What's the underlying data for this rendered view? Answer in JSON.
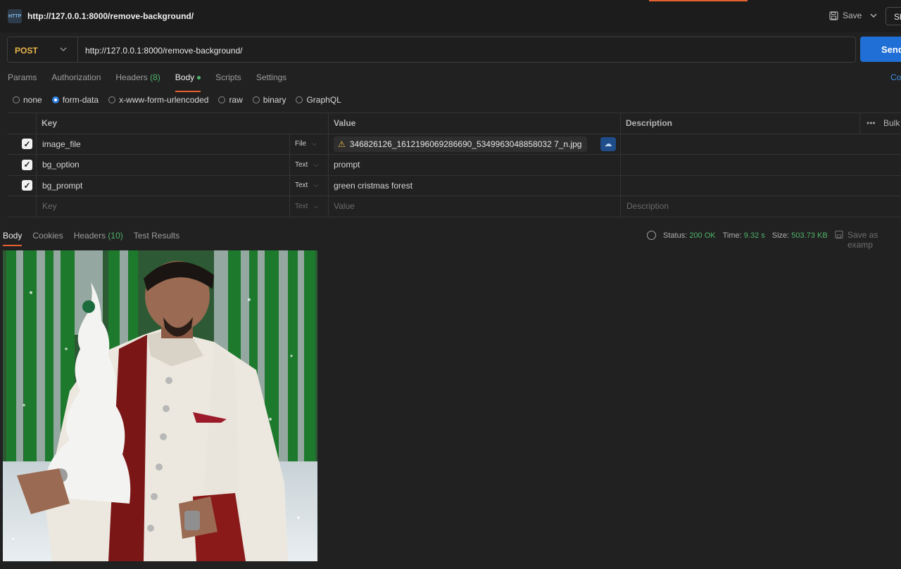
{
  "titlebar": {
    "request_title": "http://127.0.0.1:8000/remove-background/",
    "save_label": "Save",
    "share_label": "Sh",
    "req_icon_text": "HTTP"
  },
  "request": {
    "method": "POST",
    "url": "http://127.0.0.1:8000/remove-background/",
    "send_label": "Send"
  },
  "request_tabs": [
    {
      "label": "Params",
      "count": ""
    },
    {
      "label": "Authorization",
      "count": ""
    },
    {
      "label": "Headers",
      "count": "(8)"
    },
    {
      "label": "Body",
      "count": ""
    },
    {
      "label": "Scripts",
      "count": ""
    },
    {
      "label": "Settings",
      "count": ""
    }
  ],
  "code_link": "Co",
  "body_types": [
    "none",
    "form-data",
    "x-www-form-urlencoded",
    "raw",
    "binary",
    "GraphQL"
  ],
  "selected_body_type": "form-data",
  "table": {
    "headers": {
      "key": "Key",
      "value": "Value",
      "description": "Description",
      "bulk": "Bulk"
    },
    "rows": [
      {
        "key": "image_file",
        "type": "File",
        "value": "346826126_1612196069286690_5349963048858032 7_n.jpg"
      },
      {
        "key": "bg_option",
        "type": "Text",
        "value": "prompt"
      },
      {
        "key": "bg_prompt",
        "type": "Text",
        "value": "green cristmas forest"
      }
    ],
    "empty_row": {
      "key": "Key",
      "type": "Text",
      "value": "Value",
      "description": "Description"
    }
  },
  "response": {
    "tabs": [
      {
        "label": "Body",
        "count": ""
      },
      {
        "label": "Cookies",
        "count": ""
      },
      {
        "label": "Headers",
        "count": "(10)"
      },
      {
        "label": "Test Results",
        "count": ""
      }
    ],
    "status_label": "Status:",
    "status_value": "200 OK",
    "time_label": "Time:",
    "time_value": "9.32 s",
    "size_label": "Size:",
    "size_value": "503.73 KB",
    "save_example": "Save as examp"
  },
  "colors": {
    "accent_orange": "#e4602e",
    "send_blue": "#1f6fd6",
    "method_yellow": "#e9b64a",
    "status_green": "#4fb36a"
  }
}
